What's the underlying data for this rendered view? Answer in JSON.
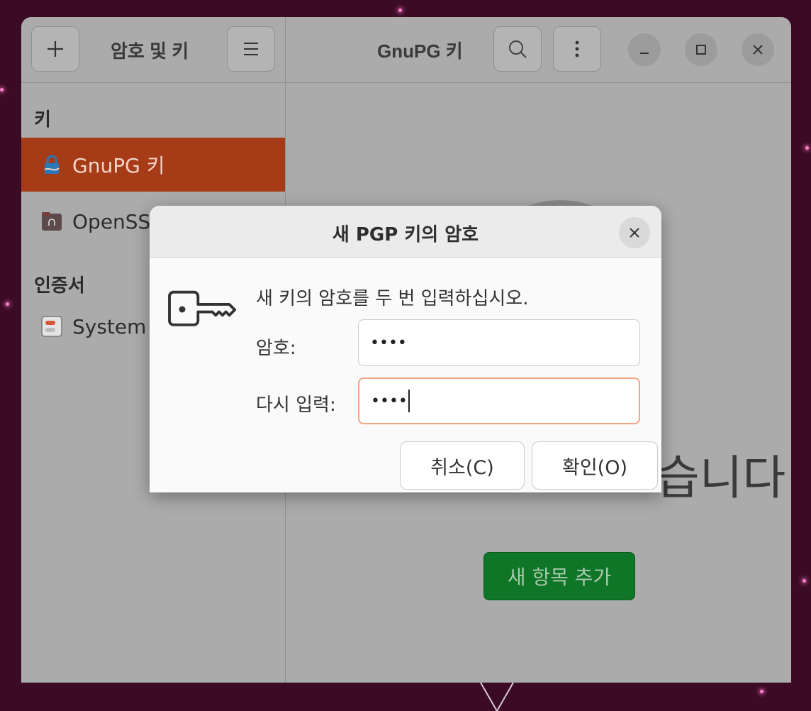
{
  "sidebar_header": {
    "title": "암호 및 키",
    "new_icon": "plus-icon",
    "menu_icon": "hamburger-icon"
  },
  "main_header": {
    "title": "GnuPG 키",
    "search_icon": "search-icon",
    "more_icon": "vertical-dots-icon"
  },
  "window_controls": [
    "minimize-icon",
    "maximize-icon",
    "close-icon"
  ],
  "sidebar": {
    "keys_heading": "키",
    "items": [
      {
        "label": "GnuPG 키",
        "icon": "gnupg-key-icon",
        "active": true
      },
      {
        "label": "OpenSSH",
        "icon": "ssh-folder-icon",
        "active": false
      }
    ],
    "certs_heading": "인증서",
    "cert_items": [
      {
        "label": "System Trust",
        "icon": "system-trust-icon"
      }
    ]
  },
  "main": {
    "empty_text_partial": "습니다",
    "add_button": "새 항목 추가"
  },
  "dialog": {
    "title": "새 PGP 키의 암호",
    "instruction": "새 키의 암호를 두 번 입력하십시오.",
    "password_label": "암호:",
    "password_value": "••••",
    "confirm_label": "다시 입력:",
    "confirm_value": "••••",
    "cancel_button": "취소(C)",
    "ok_button": "확인(O)",
    "icon": "key-icon"
  },
  "colors": {
    "active_item": "#a53b17",
    "add_button": "#0f7527",
    "focus_border": "#f0a584",
    "desktop_bg": "#3b0b25"
  }
}
